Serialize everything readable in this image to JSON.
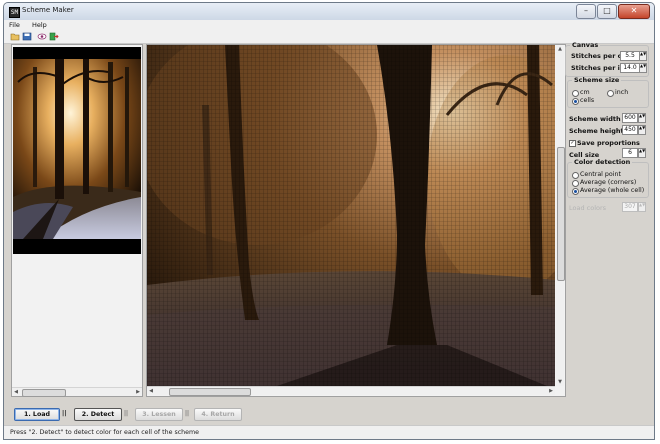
{
  "window": {
    "title": "Scheme Maker",
    "app_icon": "SM"
  },
  "caption_buttons": {
    "minimize": "–",
    "maximize": "□",
    "close": "✕"
  },
  "menu": [
    "File",
    "Help"
  ],
  "toolbar_icons": [
    "open-icon",
    "save-icon",
    "eye-icon",
    "exit-icon"
  ],
  "canvas_group": {
    "legend": "Canvas",
    "stitches_per_cm_label": "Stitches per cm",
    "stitches_per_cm": "5.5",
    "stitches_per_inch_label": "Stitches per inch",
    "stitches_per_inch": "14.0"
  },
  "scheme_size_group": {
    "legend": "Scheme size",
    "options": [
      "cm",
      "inch",
      "cells"
    ],
    "selected": "cells"
  },
  "scheme_width_label": "Scheme width",
  "scheme_width": "600",
  "scheme_height_label": "Scheme height",
  "scheme_height": "450",
  "save_proportions_label": "Save proportions",
  "save_proportions": true,
  "cell_size_label": "Cell size",
  "cell_size": "6",
  "color_detection_group": {
    "legend": "Color detection",
    "options": [
      "Central point",
      "Average (corners)",
      "Average (whole cell)"
    ],
    "selected": "Average (whole cell)"
  },
  "disabled_field_label": "Load colors",
  "disabled_field_value": "307",
  "steps": {
    "load": "1. Load",
    "detect": "2. Detect",
    "lessen": "3. Lessen",
    "return": "4. Return",
    "separator": "||"
  },
  "status": "Press \"2. Detect\" to detect color for each cell of the scheme",
  "colors": {
    "accent": "#1a4fa0",
    "close": "#c4442b"
  }
}
